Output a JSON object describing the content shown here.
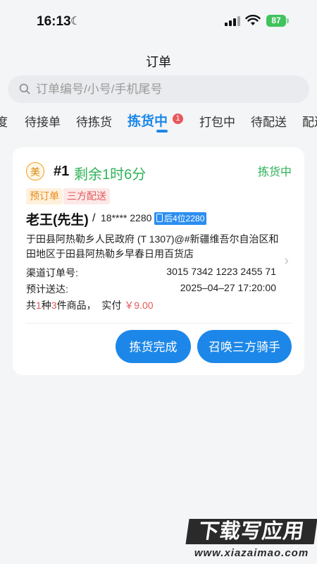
{
  "status_bar": {
    "time": "16:13",
    "battery": "87"
  },
  "page": {
    "title": "订单"
  },
  "search": {
    "placeholder": "订单编号/小号/手机尾号"
  },
  "tabs": [
    {
      "label": "度"
    },
    {
      "label": "待接单"
    },
    {
      "label": "待拣货"
    },
    {
      "label": "拣货中",
      "badge": "1",
      "active": true
    },
    {
      "label": "打包中"
    },
    {
      "label": "待配送"
    },
    {
      "label": "配送"
    }
  ],
  "order": {
    "platform": "美",
    "number": "#1",
    "remaining": "剩余1时6分",
    "status": "拣货中",
    "tags": [
      "预订单",
      "三方配送"
    ],
    "customer": "老王(先生)",
    "separator": "/",
    "phone": "18**** 2280",
    "phone_tail": "后4位2280",
    "address": "于田县阿热勒乡人民政府 (T 1307)@#新疆维吾尔自治区和田地区于田县阿热勒乡早春日用百货店",
    "channel_label": "渠道订单号:",
    "channel_value": "3015 7342 1223 2455 71",
    "delivery_label": "预计送达:",
    "delivery_value": "2025–04–27 17:20:00",
    "summary": {
      "prefix": "共",
      "kinds": "1",
      "kinds_unit": "种",
      "items": "3",
      "items_unit": "件商品，",
      "paid_label": "实付",
      "paid_value": "￥9.00"
    },
    "buttons": {
      "pick_done": "拣货完成",
      "call_rider": "召唤三方骑手"
    }
  },
  "watermark": {
    "main": "下载写应用",
    "sub": "www.xiazaimao.com"
  }
}
